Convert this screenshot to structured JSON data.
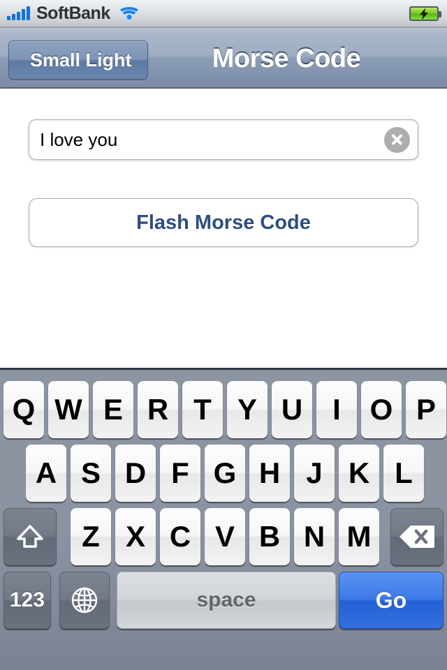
{
  "status_bar": {
    "carrier": "SoftBank",
    "signal_bars": 5,
    "wifi_icon": "wifi-icon",
    "battery_icon": "battery-charging-icon",
    "battery_color": "#76cc22"
  },
  "nav_bar": {
    "back_label": "Small Light",
    "title": "Morse Code",
    "accent_color": "#7c8dab"
  },
  "content": {
    "text_field": {
      "value": "I love you",
      "placeholder": "",
      "clear_icon": "clear-circle-icon"
    },
    "flash_button": {
      "label": "Flash Morse Code",
      "text_color": "#2e4e80"
    }
  },
  "keyboard": {
    "row1": [
      "Q",
      "W",
      "E",
      "R",
      "T",
      "Y",
      "U",
      "I",
      "O",
      "P"
    ],
    "row2": [
      "A",
      "S",
      "D",
      "F",
      "G",
      "H",
      "J",
      "K",
      "L"
    ],
    "row3": [
      "Z",
      "X",
      "C",
      "V",
      "B",
      "N",
      "M"
    ],
    "shift_label": "",
    "delete_label": "",
    "numeric_label": "123",
    "globe_label": "",
    "space_label": "space",
    "return_label": "Go",
    "return_color": "#3470de"
  }
}
